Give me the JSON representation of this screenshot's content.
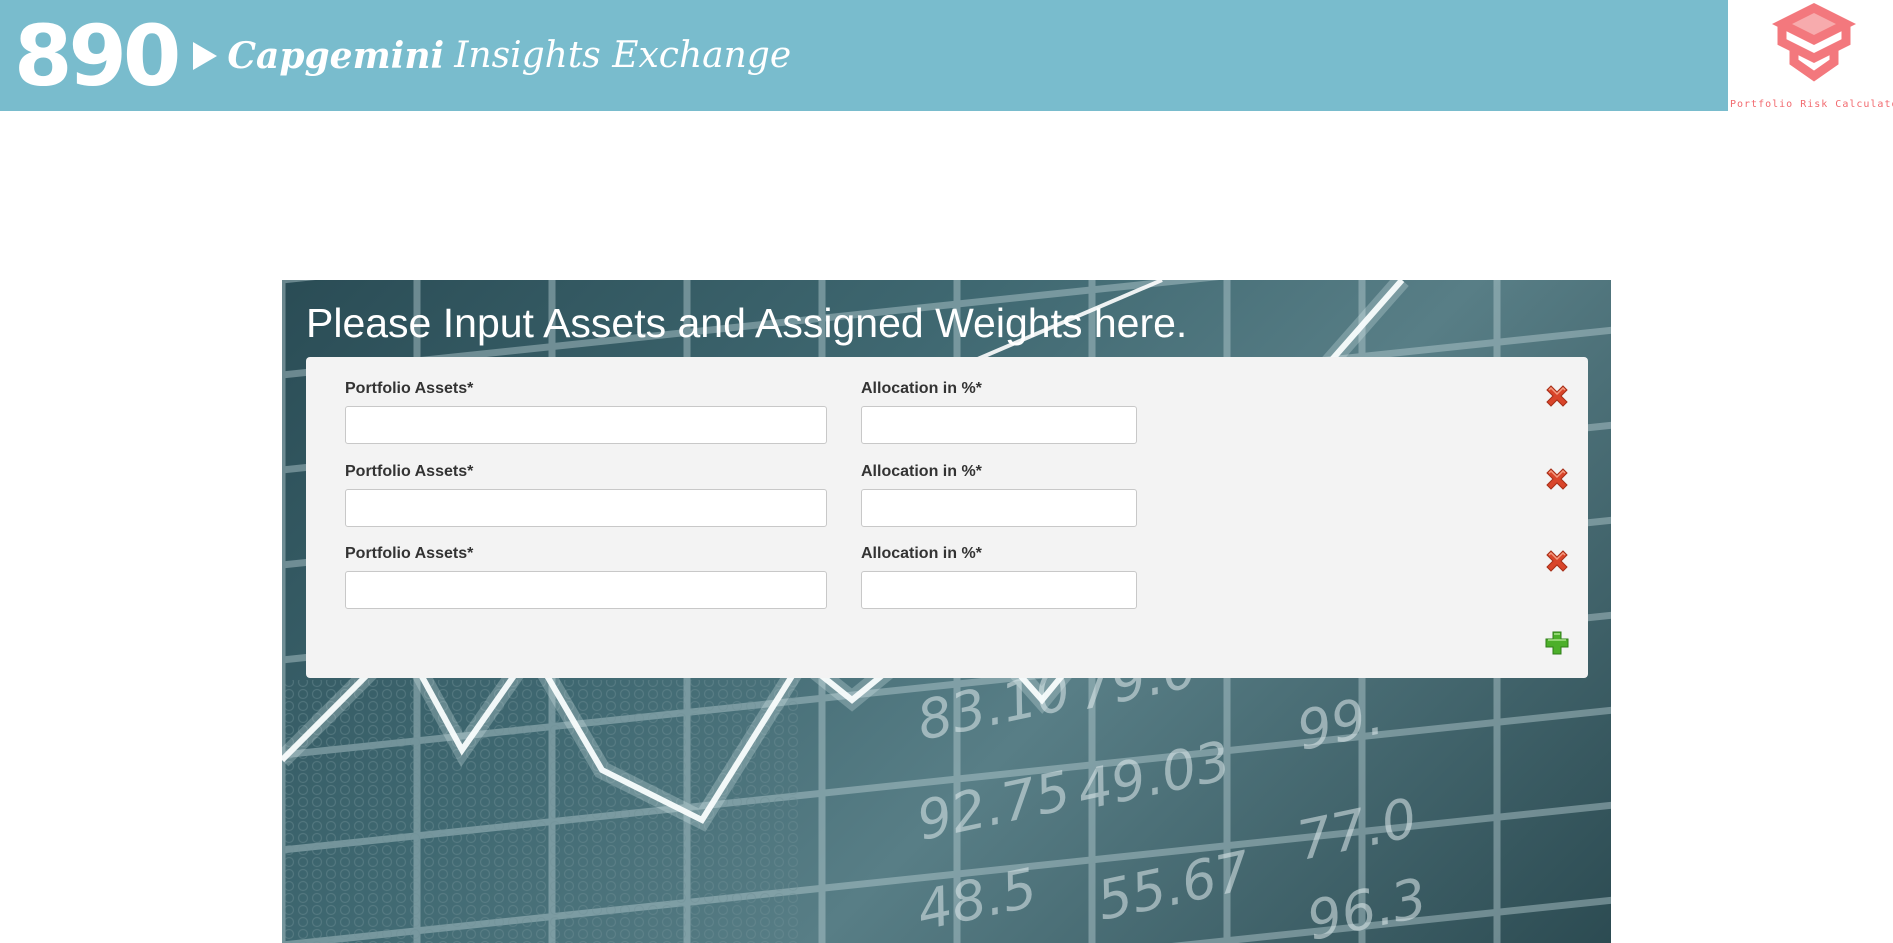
{
  "header": {
    "number": "890",
    "brand": "Capgemini",
    "subtitle": "Insights Exchange",
    "logo_caption": "Portfolio Risk Calculator"
  },
  "hero": {
    "title": "Please Input Assets and Assigned Weights here."
  },
  "form": {
    "rows": [
      {
        "asset_label": "Portfolio Assets*",
        "asset_value": "",
        "allocation_label": "Allocation in %*",
        "allocation_value": ""
      },
      {
        "asset_label": "Portfolio Assets*",
        "asset_value": "",
        "allocation_label": "Allocation in %*",
        "allocation_value": ""
      },
      {
        "asset_label": "Portfolio Assets*",
        "asset_value": "",
        "allocation_label": "Allocation in %*",
        "allocation_value": ""
      }
    ],
    "remove_icon": "red-x-icon",
    "add_icon": "green-plus-icon"
  },
  "colors": {
    "banner": "#79bccd",
    "logo": "#f26a6f",
    "card": "#f3f3f3",
    "remove": "#d9452a",
    "add": "#4caf2a"
  }
}
